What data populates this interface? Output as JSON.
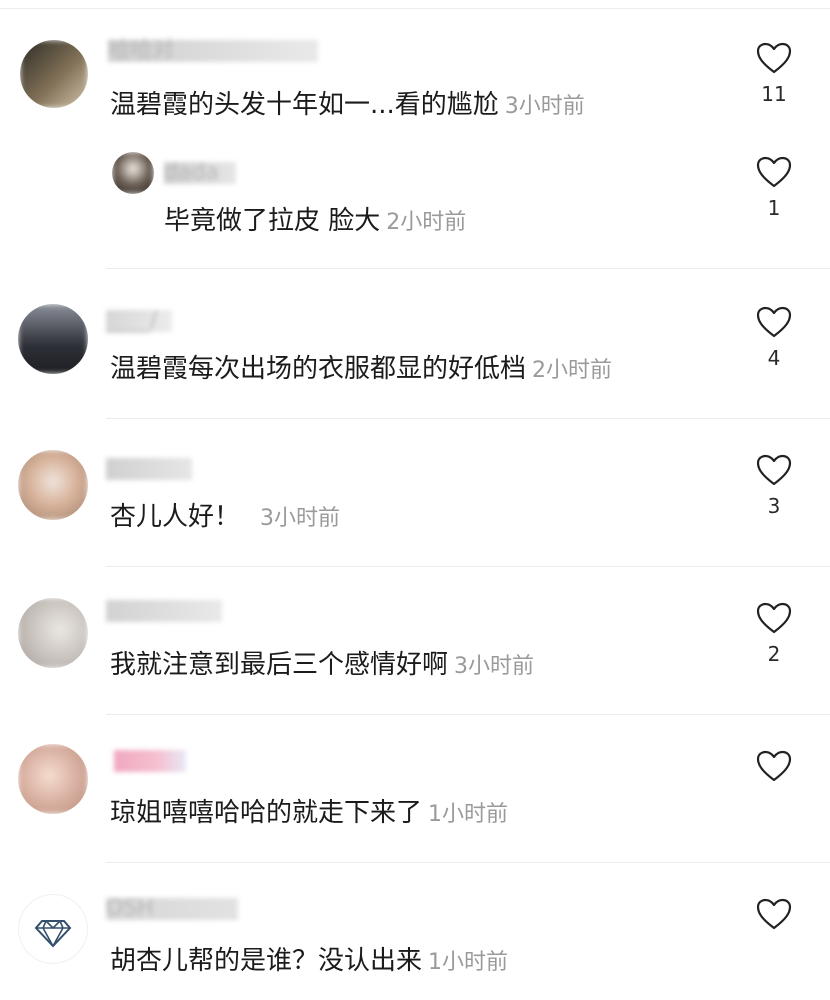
{
  "comments": [
    {
      "username": "哈哈对",
      "text": "温碧霞的头发十年如一...看的尴尬",
      "time": "3小时前",
      "likes": "11",
      "avatar_colors": [
        "#3c3a33",
        "#8a7a58",
        "#d7cbb5"
      ],
      "reply": {
        "username": "dada",
        "text": "毕竟做了拉皮 脸大",
        "time": "2小时前",
        "likes": "1",
        "avatar_colors": [
          "#2d2a27",
          "#f2eee9",
          "#5a5048"
        ]
      }
    },
    {
      "username": "____/",
      "text": "温碧霞每次出场的衣服都显的好低档",
      "time": "2小时前",
      "likes": "4",
      "avatar_colors": [
        "#2d2f37",
        "#646a78",
        "#a7aab2"
      ]
    },
    {
      "username": "",
      "text": "杏儿人好！",
      "time": "3小时前",
      "likes": "3",
      "avatar_colors": [
        "#d8b39b",
        "#9f7f6c",
        "#efe4dc"
      ]
    },
    {
      "username": "",
      "text": "我就注意到最后三个感情好啊",
      "time": "3小时前",
      "likes": "2",
      "avatar_colors": [
        "#cac4bf",
        "#a69d98",
        "#ebe7e3"
      ]
    },
    {
      "username": "",
      "text": "琼姐嘻嘻哈哈的就走下来了",
      "time": "1小时前",
      "likes": "",
      "avatar_colors": [
        "#d8b0a1",
        "#f4d4d4",
        "#c9a08d"
      ],
      "name_color": "#f0a8bf"
    },
    {
      "username": "OSH",
      "text": "胡杏儿帮的是谁？没认出来",
      "time": "1小时前",
      "likes": "",
      "avatar_colors": [
        "#ffffff",
        "#3c5470",
        "#ffffff"
      ],
      "avatar_icon": "diamond-icon"
    }
  ]
}
